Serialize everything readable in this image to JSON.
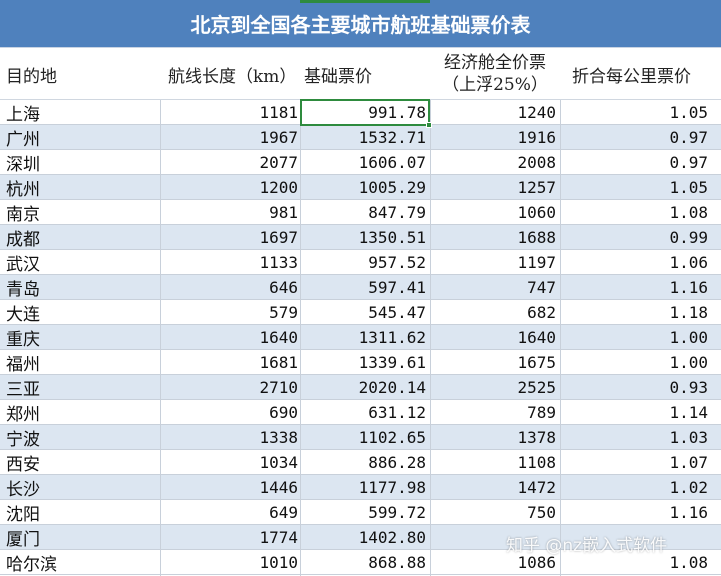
{
  "title": "北京到全国各主要城市航班基础票价表",
  "headers": {
    "destination": "目的地",
    "distance": "航线长度（km）",
    "base_fare": "基础票价",
    "economy_line1": "经济舱全价票",
    "economy_line2": "（上浮25%）",
    "per_km": "折合每公里票价"
  },
  "rows": [
    {
      "city": "上海",
      "distance": "1181",
      "base_fare": "991.78",
      "economy": "1240",
      "per_km": "1.05"
    },
    {
      "city": "广州",
      "distance": "1967",
      "base_fare": "1532.71",
      "economy": "1916",
      "per_km": "0.97"
    },
    {
      "city": "深圳",
      "distance": "2077",
      "base_fare": "1606.07",
      "economy": "2008",
      "per_km": "0.97"
    },
    {
      "city": "杭州",
      "distance": "1200",
      "base_fare": "1005.29",
      "economy": "1257",
      "per_km": "1.05"
    },
    {
      "city": "南京",
      "distance": "981",
      "base_fare": "847.79",
      "economy": "1060",
      "per_km": "1.08"
    },
    {
      "city": "成都",
      "distance": "1697",
      "base_fare": "1350.51",
      "economy": "1688",
      "per_km": "0.99"
    },
    {
      "city": "武汉",
      "distance": "1133",
      "base_fare": "957.52",
      "economy": "1197",
      "per_km": "1.06"
    },
    {
      "city": "青岛",
      "distance": "646",
      "base_fare": "597.41",
      "economy": "747",
      "per_km": "1.16"
    },
    {
      "city": "大连",
      "distance": "579",
      "base_fare": "545.47",
      "economy": "682",
      "per_km": "1.18"
    },
    {
      "city": "重庆",
      "distance": "1640",
      "base_fare": "1311.62",
      "economy": "1640",
      "per_km": "1.00"
    },
    {
      "city": "福州",
      "distance": "1681",
      "base_fare": "1339.61",
      "economy": "1675",
      "per_km": "1.00"
    },
    {
      "city": "三亚",
      "distance": "2710",
      "base_fare": "2020.14",
      "economy": "2525",
      "per_km": "0.93"
    },
    {
      "city": "郑州",
      "distance": "690",
      "base_fare": "631.12",
      "economy": "789",
      "per_km": "1.14"
    },
    {
      "city": "宁波",
      "distance": "1338",
      "base_fare": "1102.65",
      "economy": "1378",
      "per_km": "1.03"
    },
    {
      "city": "西安",
      "distance": "1034",
      "base_fare": "886.28",
      "economy": "1108",
      "per_km": "1.07"
    },
    {
      "city": "长沙",
      "distance": "1446",
      "base_fare": "1177.98",
      "economy": "1472",
      "per_km": "1.02"
    },
    {
      "city": "沈阳",
      "distance": "649",
      "base_fare": "599.72",
      "economy": "750",
      "per_km": "1.16"
    },
    {
      "city": "厦门",
      "distance": "1774",
      "base_fare": "1402.80",
      "economy": "",
      "per_km": ""
    },
    {
      "city": "哈尔滨",
      "distance": "1010",
      "base_fare": "868.88",
      "economy": "1086",
      "per_km": "1.08"
    }
  ],
  "watermark": "知乎 @nz嵌入式软件",
  "colors": {
    "title_bg": "#4f81bd",
    "band_bg": "#dce6f1",
    "selection": "#2e8b3e"
  }
}
